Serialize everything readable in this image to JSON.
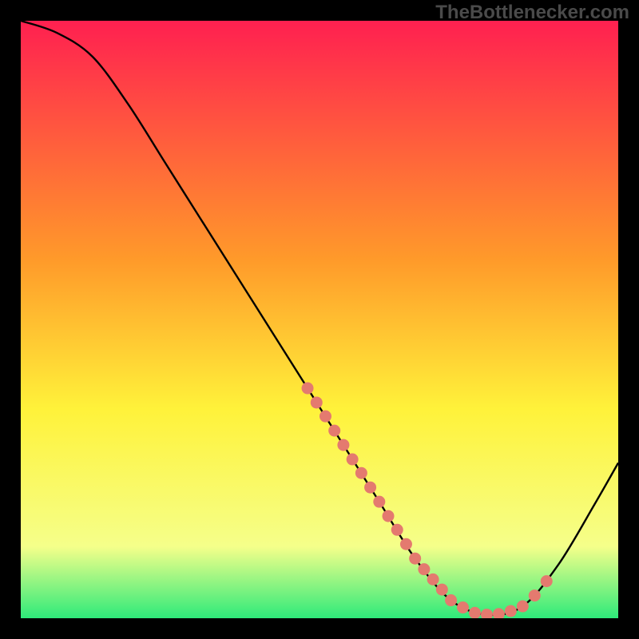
{
  "watermark": "TheBottlenecker.com",
  "chart_data": {
    "type": "line",
    "title": "",
    "xlabel": "",
    "ylabel": "",
    "xlim": [
      0,
      100
    ],
    "ylim": [
      0,
      100
    ],
    "grid": false,
    "curve": [
      {
        "x": 0,
        "y": 100
      },
      {
        "x": 6,
        "y": 98
      },
      {
        "x": 12,
        "y": 94
      },
      {
        "x": 18,
        "y": 86
      },
      {
        "x": 24,
        "y": 76.5
      },
      {
        "x": 30,
        "y": 67
      },
      {
        "x": 36,
        "y": 57.5
      },
      {
        "x": 42,
        "y": 48
      },
      {
        "x": 48,
        "y": 38.5
      },
      {
        "x": 54,
        "y": 29
      },
      {
        "x": 60,
        "y": 19.5
      },
      {
        "x": 66,
        "y": 10
      },
      {
        "x": 72,
        "y": 3
      },
      {
        "x": 78,
        "y": 0.6
      },
      {
        "x": 84,
        "y": 2
      },
      {
        "x": 90,
        "y": 9
      },
      {
        "x": 96,
        "y": 19
      },
      {
        "x": 100,
        "y": 26
      }
    ],
    "markers": [
      {
        "x": 48,
        "y": 38.5
      },
      {
        "x": 49.5,
        "y": 36.1
      },
      {
        "x": 51,
        "y": 33.8
      },
      {
        "x": 52.5,
        "y": 31.4
      },
      {
        "x": 54,
        "y": 29
      },
      {
        "x": 55.5,
        "y": 26.6
      },
      {
        "x": 57,
        "y": 24.3
      },
      {
        "x": 58.5,
        "y": 21.9
      },
      {
        "x": 60,
        "y": 19.5
      },
      {
        "x": 61.5,
        "y": 17.1
      },
      {
        "x": 63,
        "y": 14.8
      },
      {
        "x": 64.5,
        "y": 12.4
      },
      {
        "x": 66,
        "y": 10
      },
      {
        "x": 67.5,
        "y": 8.2
      },
      {
        "x": 69,
        "y": 6.5
      },
      {
        "x": 70.5,
        "y": 4.8
      },
      {
        "x": 72,
        "y": 3
      },
      {
        "x": 74,
        "y": 1.8
      },
      {
        "x": 76,
        "y": 0.9
      },
      {
        "x": 78,
        "y": 0.6
      },
      {
        "x": 80,
        "y": 0.7
      },
      {
        "x": 82,
        "y": 1.2
      },
      {
        "x": 84,
        "y": 2
      },
      {
        "x": 86,
        "y": 3.8
      },
      {
        "x": 88,
        "y": 6.2
      }
    ],
    "background_gradient": {
      "top": "#ff2050",
      "mid1": "#ff9a2a",
      "mid2": "#fff23a",
      "mid3": "#f5ff8a",
      "bottom": "#2eea7a"
    },
    "line_color": "#000000",
    "marker_color": "#e47a6f"
  }
}
